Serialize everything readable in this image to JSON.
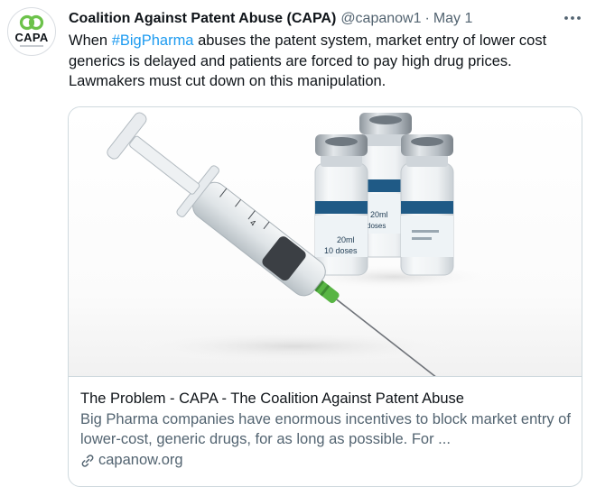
{
  "account": {
    "display_name": "Coalition Against Patent Abuse (CAPA)",
    "handle": "@capanow1",
    "date": "May 1",
    "avatar_text": "CAPA",
    "avatar_color": "#6cc24a"
  },
  "tweet": {
    "text_before": "When ",
    "hashtag": "#BigPharma",
    "text_after": " abuses the patent system, market entry of lower cost generics is delayed and patients are forced to pay high drug prices. Lawmakers must cut down on this manipulation."
  },
  "card": {
    "title": "The Problem - CAPA - The Coalition Against Patent Abuse",
    "description": "Big Pharma companies have enormous incentives to block market entry of lower-cost, generic drugs, for as long as possible. For ...",
    "domain": "capanow.org",
    "vial_label": "20ml",
    "vial_doses": "10 doses",
    "syringe_scale": "4"
  },
  "colors": {
    "hashtag": "#1d9bf0",
    "muted": "#536471",
    "border": "#cfd9de"
  }
}
